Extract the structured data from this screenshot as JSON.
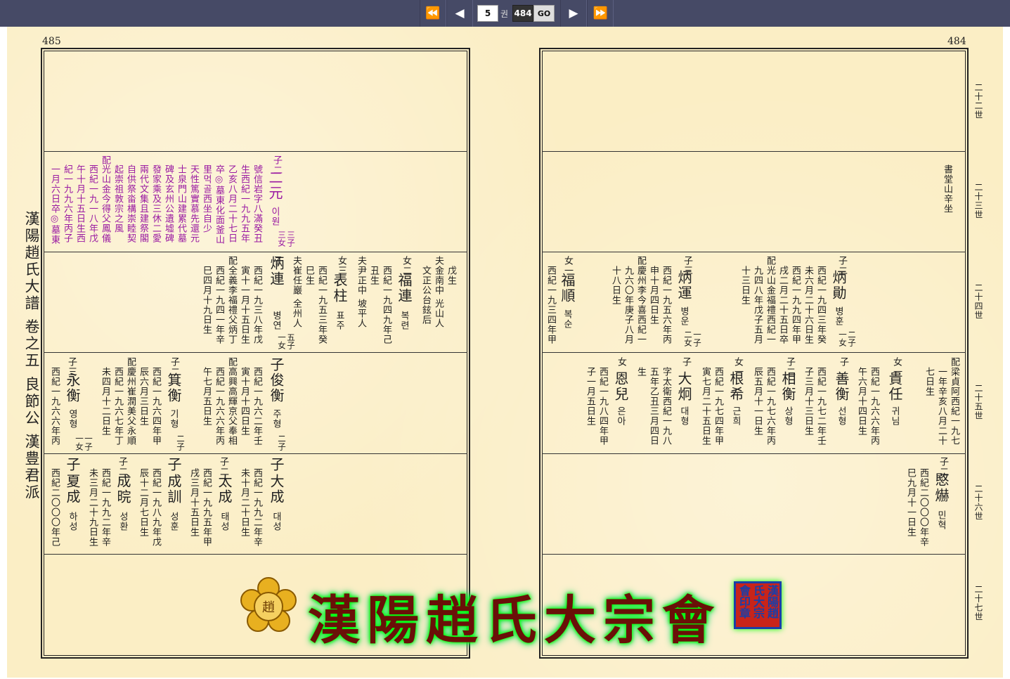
{
  "toolbar": {
    "first": "⏪",
    "prev": "◀",
    "volume": "5",
    "volume_unit": "권",
    "page": "484",
    "go": "GO",
    "next": "▶",
    "last": "⏩"
  },
  "page_left": "485",
  "page_right": "484",
  "spine": "漢陽趙氏大譜 卷之五 良節公 漢豊君派",
  "generations": [
    "二十二世",
    "二十三世",
    "二十四世",
    "二十五世",
    "二十六世",
    "二十七世"
  ],
  "right": {
    "r1": {
      "note": "書堂山辛坐"
    },
    "r2": {
      "a_label": "子二",
      "a_name": "炳勛",
      "a_kr": "병훈",
      "a_sub": "二子\n一女",
      "a_l1": "西紀一九四三年癸",
      "a_l2": "未六月二十六日生",
      "a_l3": "西紀一九九四年甲",
      "a_l4": "戌二月二十五日卒",
      "a_sp_lbl": "配",
      "a_sp1": "光山金福禮西紀一",
      "a_sp2": "九四八年戊子五月",
      "a_sp3": "十三日生",
      "b_label": "子三",
      "b_name": "炳運",
      "b_kr": "병운",
      "b_sub": "一子\n二女",
      "b_l1": "西紀一九五六年丙",
      "b_l2": "申十月四日生",
      "b_sp_lbl": "配",
      "b_sp1": "慶州李今喜西紀一",
      "b_sp2": "九六〇年庚子八月",
      "b_sp3": "十八日生",
      "c_label": "女一",
      "c_name": "福順",
      "c_kr": "복순",
      "c_l1": "西紀一九三四年甲"
    },
    "r3": {
      "a_sp_lbl": "配",
      "a_sp1": "梁貞阿西紀一九七",
      "a_sp2": "一年辛亥八月二十",
      "a_sp3": "七日生",
      "b_label": "女一",
      "b_name": "貴任",
      "b_kr": "귀님",
      "b_l1": "西紀一九六六年丙",
      "b_l2": "午六月十四日生",
      "c_label": "子",
      "c_name": "善衡",
      "c_kr": "선형",
      "d_label": "子二",
      "d_name": "相衡",
      "d_kr": "상형",
      "d_l1": "西紀一九七二年壬",
      "d_l2": "子三月十三日生",
      "d_l3": "西紀一九七六年丙",
      "d_l4": "辰五月十一日生",
      "e_label": "女一",
      "e_name": "根希",
      "e_kr": "근희",
      "e_l1": "西紀一九七四年甲",
      "e_l2": "寅七月二十五日生",
      "f_label": "子",
      "f_name": "大炯",
      "f_kr": "대형",
      "f_l1": "字太衛西紀一九八",
      "f_l2": "五年乙丑三月四日",
      "f_l3": "生",
      "g_label": "女",
      "g_name": "恩兒",
      "g_kr": "은아",
      "g_l1": "西紀一九八四年甲",
      "g_l2": "子一月五日生"
    },
    "r4": {
      "a_label": "子二",
      "a_name": "愍爀",
      "a_kr": "민혁",
      "a_l1": "西紀二〇〇〇年辛",
      "a_l2": "巳九月十一日生"
    }
  },
  "left": {
    "r2": {
      "a_label": "子二",
      "a_name": "二元",
      "a_kr": "이원",
      "a_sub": "三子\n三女",
      "a_l1": "號信岩字八滿癸丑",
      "a_l2": "生西紀一九九五年",
      "a_l3": "乙亥八月二十七日",
      "a_l4": "卒◎墓東化面釜山",
      "a_l5": "里먹골西坐自少",
      "a_l6": "天性篤實慕先還元",
      "a_l7": "士泉門山建累代墓",
      "a_l8": "碑及玄州公遺墟碑",
      "a_l9": "發家乘及三休二愛",
      "a_l10": "兩代文集且建祭閣",
      "a_l11": "自供祭畓構崇睦契",
      "a_l12": "起崇祖敦宗之風",
      "a_sp_lbl": "配",
      "a_sp1": "光山金今得父鳳儀",
      "a_sp2": "西紀一九一八年戊",
      "a_sp3": "午十月十五日生西",
      "a_sp4": "紀一九九六年丙子",
      "a_sp5": "一月六日卒◎墓東"
    },
    "r3": {
      "a_l1": "戊生",
      "a_l2": "夫金南中 光山人",
      "a_l3": "文正公台鉉后",
      "b_label": "女二",
      "b_name": "福連",
      "b_kr": "복련",
      "b_l1": "西紀一九四九年己",
      "b_l2": "丑生",
      "c_l1": "夫尹正中 坡平人",
      "d_label": "女三",
      "d_name": "表柱",
      "d_kr": "표주",
      "d_l1": "西紀一九五三年癸",
      "d_l2": "巳生",
      "e_l1": "夫崔任巖 全州人",
      "f_label": "子",
      "f_name": "炳連",
      "f_kr": "병연",
      "f_sub": "五子\n一女",
      "f_l1": "西紀一九三八年戊",
      "f_l2": "寅十一月十五日生",
      "f_sp_lbl": "配",
      "f_sp1": "全義李福禮父炳丁",
      "f_sp2": "西紀一九四一年辛",
      "f_sp3": "巳四月十九日生"
    },
    "r4": {
      "a_label": "子",
      "a_name": "俊衡",
      "a_kr": "주형",
      "a_sub": "二子",
      "a_l1": "西紀一九六二年壬",
      "a_l2": "寅十月十四日生",
      "a_sp_lbl": "配",
      "a_sp1": "高興高輝京父奉相",
      "a_sp2": "西紀一九六六年丙",
      "a_sp3": "午七月五日生",
      "b_label": "子二",
      "b_name": "箕衡",
      "b_kr": "기형",
      "b_sub": "二子",
      "b_l1": "西紀一九六四年甲",
      "b_l2": "辰六月三日生",
      "b_sp_lbl": "配",
      "b_sp1": "慶州崔潤美父永順",
      "b_sp2": "西紀一九六七年丁",
      "b_sp3": "未四月十二日生",
      "c_label": "子三",
      "c_name": "永衡",
      "c_kr": "영형",
      "c_sub": "一子\n一女",
      "c_l1": "西紀一九六六年丙"
    },
    "r5": {
      "a_label": "子",
      "a_name": "大成",
      "a_kr": "대성",
      "a_l1": "西紀一九九二年辛",
      "a_l2": "未十月二十日生",
      "b_label": "子二",
      "b_name": "太成",
      "b_kr": "태성",
      "b_l1": "西紀一九九五年甲",
      "b_l2": "戌三月十五日生",
      "c_label": "子",
      "c_name": "成訓",
      "c_kr": "성훈",
      "c_l1": "西紀一九八九年戊",
      "c_l2": "辰十二月七日生",
      "d_label": "子二",
      "d_name": "成晥",
      "d_kr": "성환",
      "d_l1": "西紀一九九二年辛",
      "d_l2": "未三月二十九日生",
      "e_label": "子",
      "e_name": "夏成",
      "e_kr": "하성",
      "e_l1": "西紀二〇〇〇年己"
    }
  },
  "banner": {
    "title": "漢陽趙氏大宗會",
    "seal": "漢陽趙氏大宗會印章",
    "emblem": "趙"
  }
}
